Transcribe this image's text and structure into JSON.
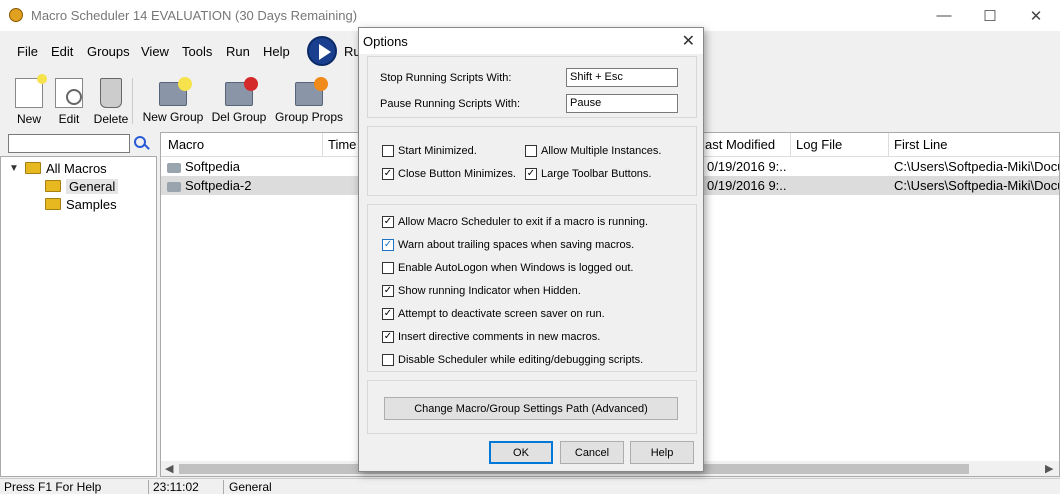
{
  "window": {
    "title": "Macro Scheduler 14 EVALUATION (30 Days Remaining)",
    "minimize": "—",
    "maximize": "☐",
    "close": "✕"
  },
  "menu": {
    "items": [
      "File",
      "Edit",
      "Groups",
      "View",
      "Tools",
      "Run",
      "Help"
    ],
    "run_label": "Ru"
  },
  "toolbar": {
    "buttons": [
      "New",
      "Edit",
      "Delete",
      "New Group",
      "Del Group",
      "Group Props"
    ]
  },
  "tree": {
    "root": "All Macros",
    "children": [
      "General",
      "Samples"
    ],
    "selected": "General"
  },
  "grid": {
    "columns": [
      "Macro",
      "Time",
      "ast Modified",
      "Log File",
      "First Line"
    ],
    "rows": [
      {
        "macro": "Softpedia",
        "modified": "0/19/2016 9:...",
        "first_line": "C:\\Users\\Softpedia-Miki\\Docur"
      },
      {
        "macro": "Softpedia-2",
        "modified": "0/19/2016 9:...",
        "first_line": "C:\\Users\\Softpedia-Miki\\Docur"
      }
    ]
  },
  "status": {
    "help": "Press F1 For Help",
    "time": "23:11:02",
    "group": "General"
  },
  "dialog": {
    "title": "Options",
    "stop_label": "Stop Running Scripts With:",
    "stop_value": "Shift + Esc",
    "pause_label": "Pause Running Scripts With:",
    "pause_value": "Pause",
    "options_grid": [
      {
        "label": "Start Minimized.",
        "checked": false
      },
      {
        "label": "Allow Multiple Instances.",
        "checked": false
      },
      {
        "label": "Close Button Minimizes.",
        "checked": true
      },
      {
        "label": "Large Toolbar Buttons.",
        "checked": true
      }
    ],
    "options_list": [
      {
        "label": "Allow Macro Scheduler to exit if a macro is running.",
        "checked": true
      },
      {
        "label": "Warn about trailing spaces when saving macros.",
        "checked": true
      },
      {
        "label": "Enable AutoLogon when Windows is logged out.",
        "checked": false
      },
      {
        "label": "Show running Indicator when Hidden.",
        "checked": true
      },
      {
        "label": "Attempt to deactivate screen saver on run.",
        "checked": true
      },
      {
        "label": "Insert directive comments in new macros.",
        "checked": true
      },
      {
        "label": "Disable Scheduler while editing/debugging scripts.",
        "checked": false
      }
    ],
    "path_button": "Change Macro/Group Settings Path (Advanced)",
    "ok": "OK",
    "cancel": "Cancel",
    "help": "Help"
  },
  "colors": {
    "accent": "#0078d7",
    "folder": "#e8b820"
  }
}
